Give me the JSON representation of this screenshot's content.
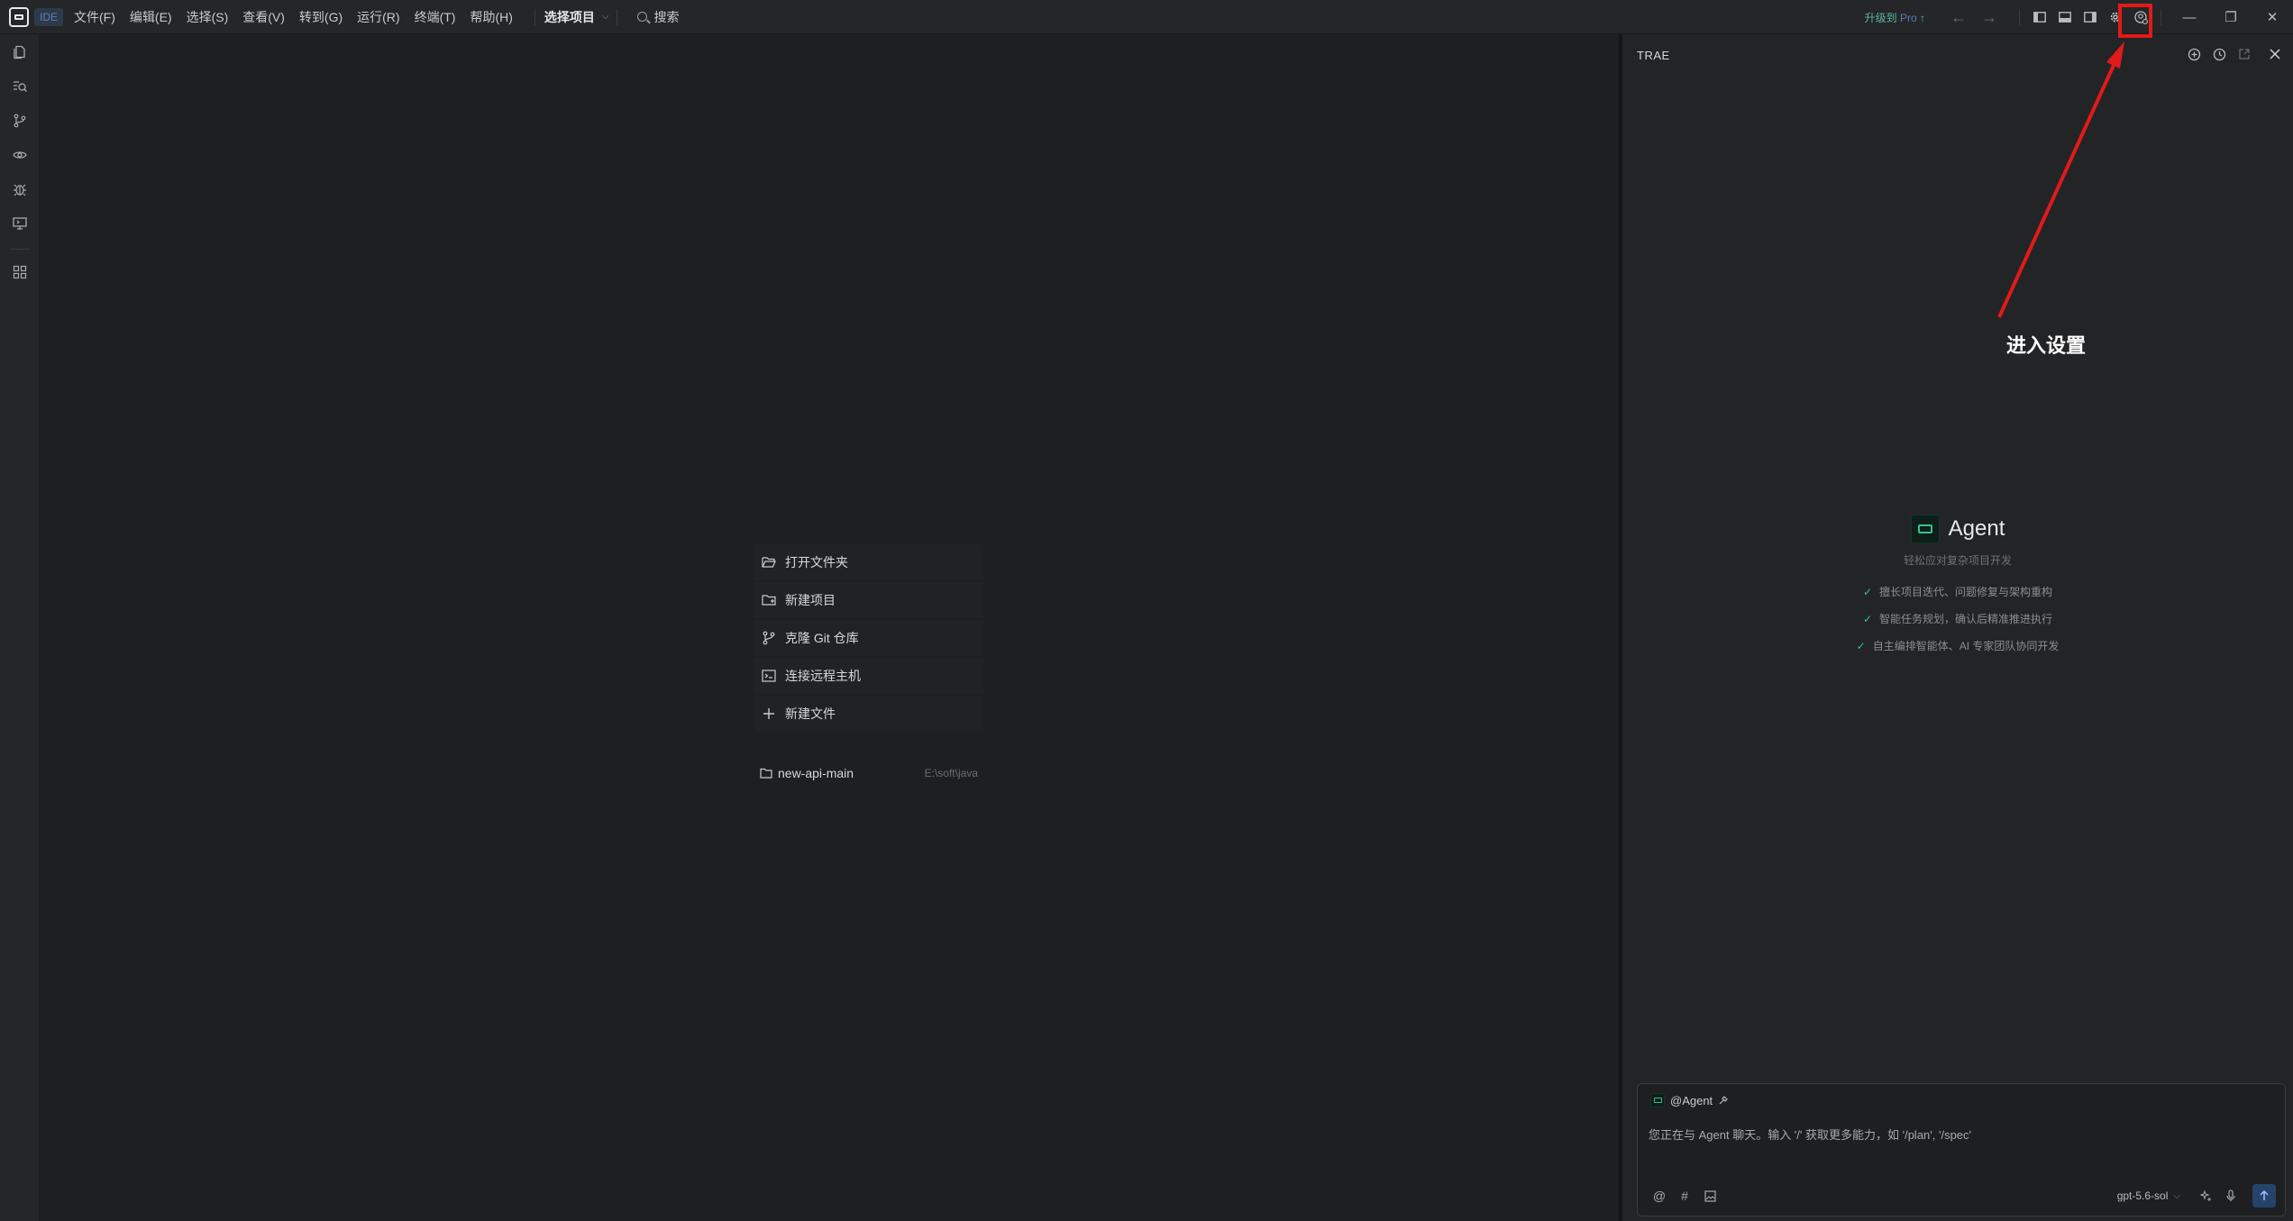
{
  "titlebar": {
    "ide_label": "IDE",
    "menus": [
      "文件(F)",
      "编辑(E)",
      "选择(S)",
      "查看(V)",
      "转到(G)",
      "运行(R)",
      "终端(T)",
      "帮助(H)"
    ],
    "project_label": "选择项目",
    "search_label": "搜索",
    "upgrade_text": "升级到",
    "upgrade_pro": "Pro",
    "upgrade_arrow": "↑"
  },
  "welcome": {
    "actions": [
      "打开文件夹",
      "新建项目",
      "克隆 Git 仓库",
      "连接远程主机",
      "新建文件"
    ],
    "recent": {
      "name": "new-api-main",
      "path": "E:\\soft\\java"
    }
  },
  "panel": {
    "title": "TRAE",
    "agent_name": "Agent",
    "agent_subtitle": "轻松应对复杂项目开发",
    "features": [
      "擅长项目迭代、问题修复与架构重构",
      "智能任务规划，确认后精准推进执行",
      "自主编排智能体、AI 专家团队协同开发"
    ],
    "chat_tag": "@Agent",
    "chat_placeholder": "您正在与 Agent 聊天。输入 '/' 获取更多能力，如 '/plan', '/spec'",
    "model": "gpt-5.6-sol"
  },
  "annotation": {
    "text": "进入设置",
    "color": "#e21a1a"
  },
  "colors": {
    "accent_green": "#35c48f",
    "send_bg": "#27436a"
  }
}
